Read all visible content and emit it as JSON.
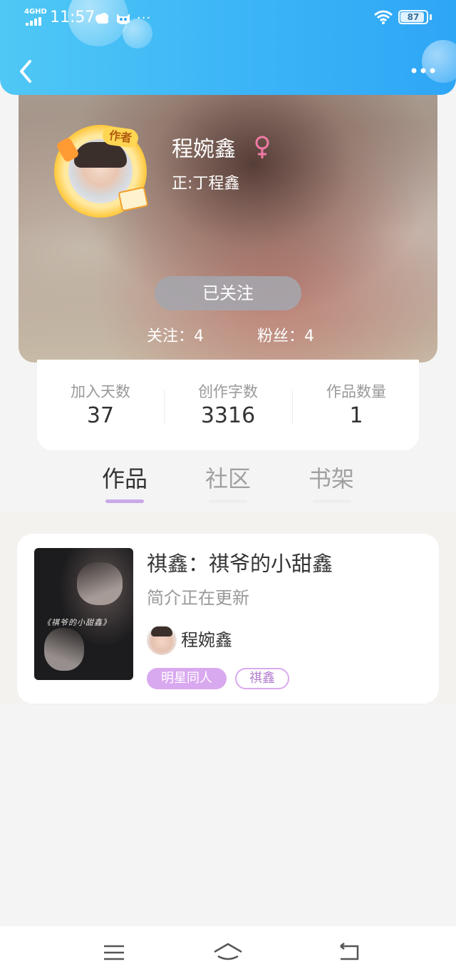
{
  "status_bar": {
    "network": "4GHD",
    "time": "11:57",
    "extra": "···",
    "battery": "87",
    "icons": [
      "signal-icon",
      "cloud-icon",
      "cat-face-icon",
      "wifi-icon",
      "battery-icon"
    ]
  },
  "header": {
    "back_icon": "chevron-left-icon",
    "more_icon": "more-dots-icon",
    "background_colors": [
      "#4fc8f5",
      "#2ea6f6"
    ]
  },
  "profile": {
    "author_badge": "作者",
    "name": "程婉鑫",
    "gender_icon": "female-icon",
    "gender_color": "#f07aa6",
    "subtitle": "正:丁程鑫",
    "follow_button": "已关注",
    "following": "关注：4",
    "fans": "粉丝：4"
  },
  "stats": [
    {
      "label": "加入天数",
      "value": "37"
    },
    {
      "label": "创作字数",
      "value": "3316"
    },
    {
      "label": "作品数量",
      "value": "1"
    }
  ],
  "tabs": [
    {
      "label": "作品",
      "active": true
    },
    {
      "label": "社区",
      "active": false
    },
    {
      "label": "书架",
      "active": false
    }
  ],
  "tab_indicator_color": "#c9a8e8",
  "works": [
    {
      "title": "祺鑫：祺爷的小甜鑫",
      "intro": "简介正在更新",
      "author": "程婉鑫",
      "cover_text": "《祺爷的小甜鑫》",
      "tags": [
        "明星同人",
        "祺鑫"
      ]
    }
  ],
  "accent_color": "#d9a9ef",
  "nav_bar": {
    "icons": [
      "menu-icon",
      "home-icon",
      "return-icon"
    ]
  }
}
